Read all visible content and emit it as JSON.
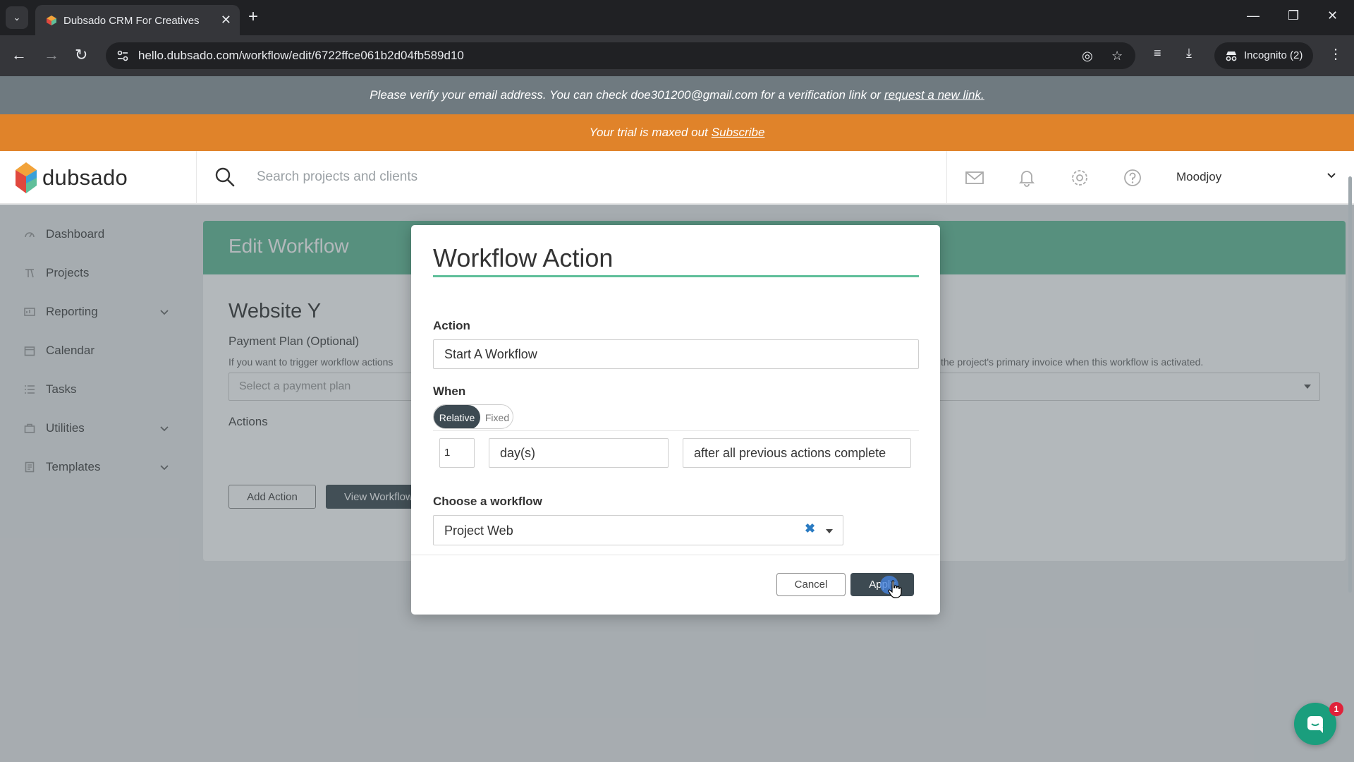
{
  "browser": {
    "tab_title": "Dubsado CRM For Creatives",
    "url": "hello.dubsado.com/workflow/edit/6722ffce061b2d04fb589d10",
    "incognito_label": "Incognito (2)"
  },
  "banners": {
    "verify_text": "Please verify your email address. You can check doe301200@gmail.com for a verification link or",
    "verify_link": "request a new link.",
    "trial_text": "Your trial is maxed out",
    "trial_link": "Subscribe"
  },
  "header": {
    "logo_text": "dubsado",
    "search_placeholder": "Search projects and clients",
    "user_name": "Moodjoy"
  },
  "sidebar": {
    "items": [
      {
        "label": "Dashboard",
        "icon": "dashboard-icon",
        "expandable": false
      },
      {
        "label": "Projects",
        "icon": "projects-icon",
        "expandable": false
      },
      {
        "label": "Reporting",
        "icon": "reporting-icon",
        "expandable": true
      },
      {
        "label": "Calendar",
        "icon": "calendar-icon",
        "expandable": false
      },
      {
        "label": "Tasks",
        "icon": "tasks-icon",
        "expandable": false
      },
      {
        "label": "Utilities",
        "icon": "utilities-icon",
        "expandable": true
      },
      {
        "label": "Templates",
        "icon": "templates-icon",
        "expandable": true
      }
    ]
  },
  "main": {
    "card_title": "Edit Workflow",
    "workflow_name": "Website Y",
    "payment_plan_label": "Payment Plan (Optional)",
    "payment_plan_help_left": "If you want to trigger workflow actions",
    "payment_plan_help_right": "the project's primary invoice when this workflow is activated.",
    "payment_plan_placeholder": "Select a payment plan",
    "actions_label": "Actions",
    "add_action_label": "Add Action",
    "view_workflow_label": "View Workflow"
  },
  "modal": {
    "title": "Workflow Action",
    "action_label": "Action",
    "action_value": "Start A Workflow",
    "when_label": "When",
    "toggle_relative": "Relative",
    "toggle_fixed": "Fixed",
    "toggle_selected": "Relative",
    "amount_value": "1",
    "unit_value": "day(s)",
    "timing_value": "after all previous actions complete",
    "choose_workflow_label": "Choose a workflow",
    "workflow_value": "Project Web",
    "cancel_label": "Cancel",
    "apply_label": "Apply"
  },
  "chat": {
    "badge_count": "1"
  },
  "colors": {
    "brand_green": "#61bb97",
    "trial_orange": "#e0832a",
    "verify_gray": "#6f7a80",
    "dark_button": "#3d4a52",
    "chat_green": "#1a9e7d"
  }
}
